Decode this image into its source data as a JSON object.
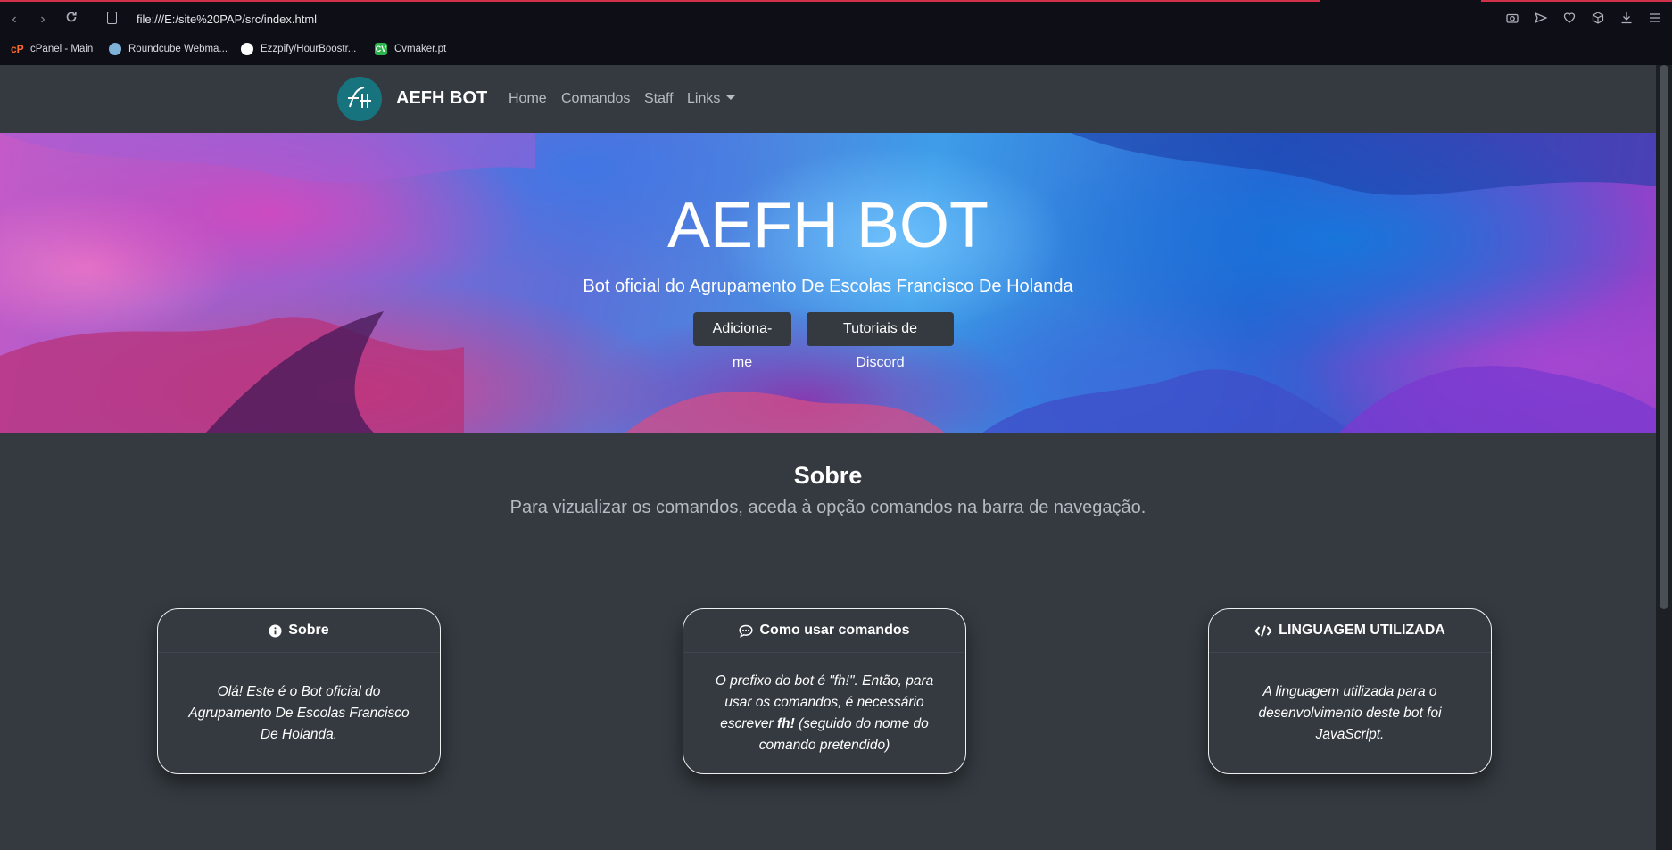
{
  "browser": {
    "url": "file:///E:/site%20PAP/src/index.html",
    "bookmarks": [
      {
        "label": "cPanel - Main",
        "icon": "cpanel-icon"
      },
      {
        "label": "Roundcube Webma...",
        "icon": "roundcube-icon"
      },
      {
        "label": "Ezzpify/HourBoostr...",
        "icon": "github-icon"
      },
      {
        "label": "Cvmaker.pt",
        "icon": "cvmaker-icon"
      }
    ],
    "cv_badge": "CV"
  },
  "navbar": {
    "brand": "AEFH BOT",
    "links": [
      "Home",
      "Comandos",
      "Staff",
      "Links"
    ]
  },
  "hero": {
    "title": "AEFH BOT",
    "subtitle": "Bot oficial do Agrupamento De Escolas Francisco De Holanda",
    "buttons": [
      "Adiciona-me",
      "Tutoriais de Discord"
    ]
  },
  "about": {
    "title": "Sobre",
    "subtitle": "Para vizualizar os comandos, aceda à opção comandos na barra de navegação."
  },
  "cards": [
    {
      "title": "Sobre",
      "icon": "info-icon",
      "body": "Olá! Este é o Bot oficial do Agrupamento De Escolas Francisco De Holanda."
    },
    {
      "title": "Como usar comandos",
      "icon": "chat-icon",
      "body_prefix": "O prefixo do bot é \"fh!\". Então, para usar os comandos, é necessário escrever ",
      "body_bold": "fh!",
      "body_suffix": " (seguido do nome do comando pretendido)"
    },
    {
      "title": "LINGUAGEM UTILIZADA",
      "icon": "code-icon",
      "body": "A linguagem utilizada para o desenvolvimento deste bot foi JavaScript."
    }
  ]
}
